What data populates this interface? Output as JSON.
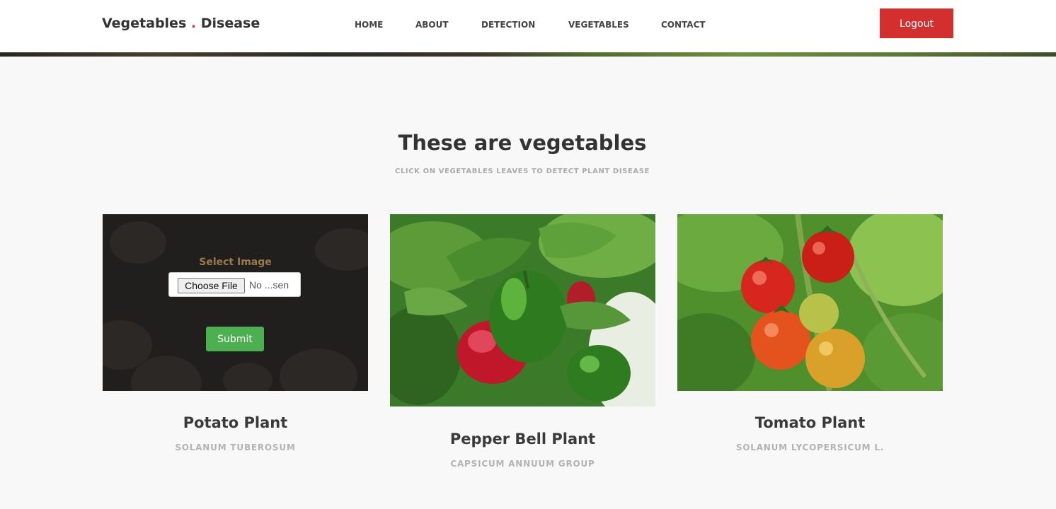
{
  "header": {
    "logo_left": "Vegetables",
    "logo_dot": ".",
    "logo_right": "Disease",
    "nav": [
      "HOME",
      "ABOUT",
      "DETECTION",
      "VEGETABLES",
      "CONTACT"
    ],
    "logout_label": "Logout"
  },
  "section": {
    "title": "These are vegetables",
    "subtitle": "CLICK ON VEGETABLES LEAVES TO DETECT PLANT DISEASE"
  },
  "cards": [
    {
      "name": "Potato Plant",
      "scientific": "SOLANUM TUBEROSUM",
      "upload": {
        "label": "Select Image",
        "file_button": "Choose File",
        "file_status": "No ...sen",
        "submit": "Submit"
      }
    },
    {
      "name": "Pepper Bell Plant",
      "scientific": "CAPSICUM ANNUUM GROUP"
    },
    {
      "name": "Tomato Plant",
      "scientific": "SOLANUM LYCOPERSICUM L."
    }
  ],
  "colors": {
    "logo_dot": "#e03131",
    "logout": "#d32f2f",
    "submit": "#4caf50",
    "select_label": "#9a7a4c"
  }
}
